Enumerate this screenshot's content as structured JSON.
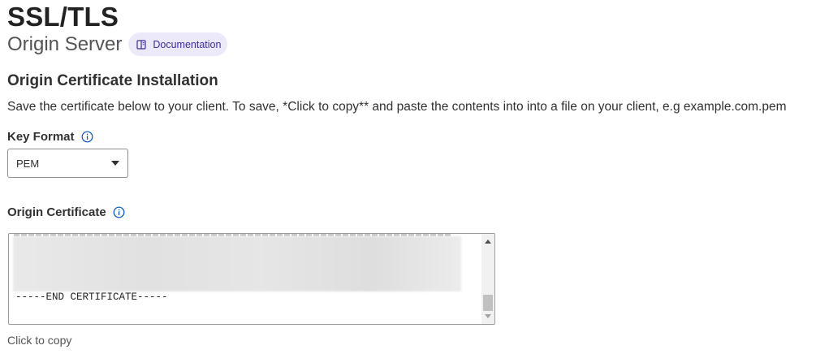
{
  "header": {
    "title": "SSL/TLS",
    "subtitle": "Origin Server",
    "documentation_label": "Documentation"
  },
  "section": {
    "title": "Origin Certificate Installation",
    "description": "Save the certificate below to your client. To save, *Click to copy** and paste the contents into into a file on your client, e.g example.com.pem"
  },
  "key_format": {
    "label": "Key Format",
    "selected": "PEM",
    "info_icon": "info-icon"
  },
  "certificate": {
    "label": "Origin Certificate",
    "info_icon": "info-icon",
    "end_line": "-----END CERTIFICATE-----",
    "copy_label": "Click to copy"
  },
  "colors": {
    "accent": "#3d2f9a",
    "pill_bg": "#ece9fb",
    "info_blue": "#0051c3"
  }
}
